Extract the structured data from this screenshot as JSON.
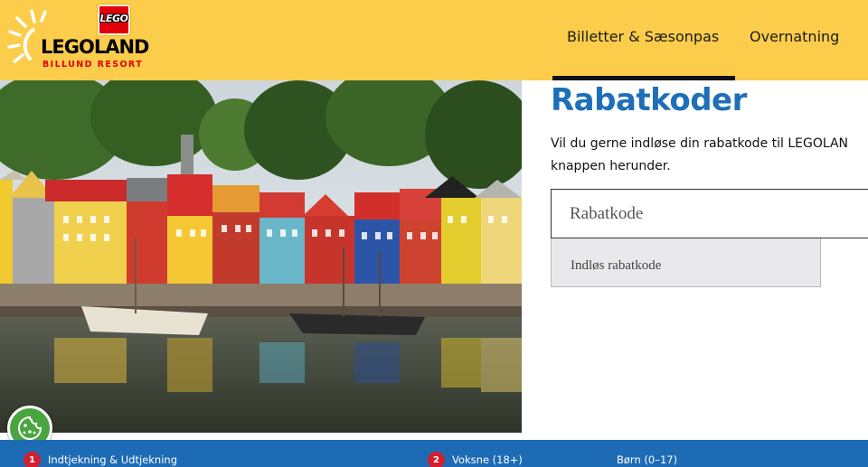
{
  "header": {
    "logo": {
      "badge_text": "LEGO",
      "brand_name": "LEGOLAND",
      "brand_sub": "BILLUND RESORT",
      "icon": "sun-logo-icon"
    },
    "nav": {
      "tickets_label": "Billetter & Sæsonpas",
      "stay_label": "Overnatning"
    }
  },
  "main": {
    "image": "miniland-nyhavn-photo",
    "title": "Rabatkoder",
    "intro_line1": "Vil du gerne indløse din rabatkode til LEGOLAN",
    "intro_line2": "knappen herunder.",
    "code_input": {
      "value": "",
      "placeholder": "Rabatkode"
    },
    "redeem_label": "Indløs rabatkode"
  },
  "cookie": {
    "icon": "cookie-icon"
  },
  "booking_bar": {
    "steps": [
      {
        "number": "1",
        "label": "Indtjekning & Udtjekning"
      },
      {
        "number": "2",
        "label": "Voksne (18+)"
      },
      {
        "number": "",
        "label": "Børn (0–17)"
      }
    ]
  },
  "colors": {
    "header_bg": "#fccd4b",
    "title_blue": "#1d6fb8",
    "bar_blue": "#1e6bb5",
    "lego_red": "#e3000b",
    "cookie_green": "#4aa540"
  }
}
